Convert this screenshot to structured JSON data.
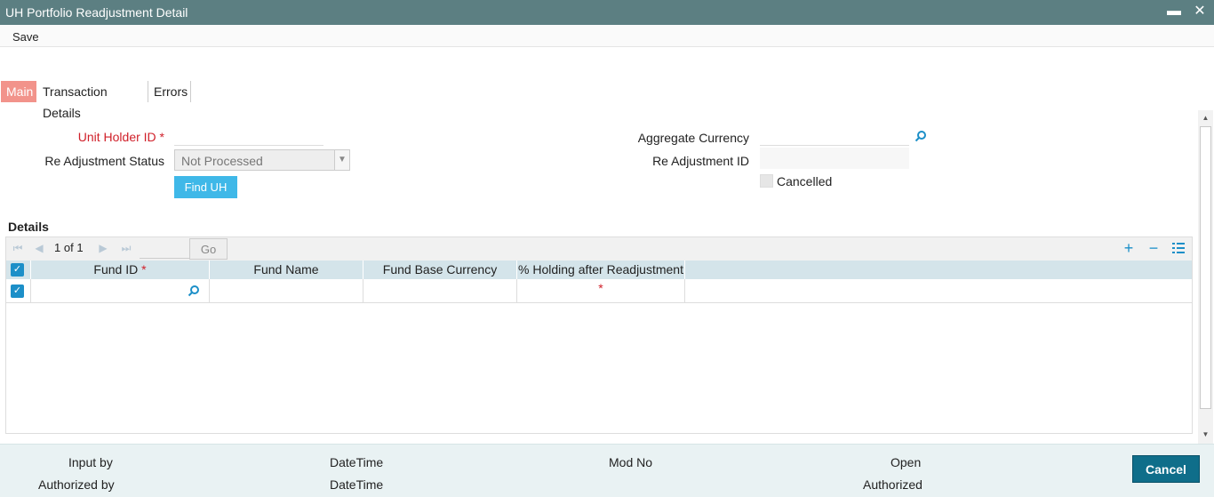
{
  "window": {
    "title": "UH Portfolio Readjustment Detail",
    "minimize_glyph": "▬",
    "close_glyph": "✕"
  },
  "toolbar": {
    "save_label": "Save"
  },
  "tabs": [
    {
      "label": "Main",
      "active": true
    },
    {
      "label": "Transaction Details",
      "active": false
    },
    {
      "label": "Errors",
      "active": false
    }
  ],
  "form": {
    "unit_holder_id": {
      "label": "Unit Holder ID",
      "required_mark": "*",
      "value": ""
    },
    "readjustment_status": {
      "label": "Re Adjustment Status",
      "value": "Not Processed"
    },
    "find_uh_label": "Find UH",
    "aggregate_currency": {
      "label": "Aggregate Currency",
      "value": ""
    },
    "readjustment_id": {
      "label": "Re Adjustment ID",
      "value": ""
    },
    "cancelled": {
      "label": "Cancelled",
      "checked": false
    }
  },
  "details": {
    "title": "Details",
    "pager": {
      "current": "1",
      "of_label": "of",
      "total": "1",
      "go_label": "Go"
    },
    "columns": [
      {
        "label": "Fund ID",
        "required_mark": "*"
      },
      {
        "label": "Fund Name",
        "required_mark": ""
      },
      {
        "label": "Fund Base Currency",
        "required_mark": ""
      },
      {
        "label": "% Holding after Readjustment",
        "required_mark": "*"
      }
    ],
    "rows": [
      {
        "fund_id": "",
        "fund_name": "",
        "fund_base_currency": "",
        "holding_pct": ""
      }
    ]
  },
  "footer": {
    "input_by": "Input by",
    "authorized_by": "Authorized by",
    "datetime_1": "DateTime",
    "datetime_2": "DateTime",
    "mod_no": "Mod No",
    "open": "Open",
    "authorized": "Authorized",
    "cancel_label": "Cancel"
  },
  "colors": {
    "titlebar": "#5c7f82",
    "active_tab": "#f2938b",
    "button": "#3fb8e8",
    "accent": "#1c8fc8",
    "cancel": "#0f6e8a",
    "required": "#d0202a"
  },
  "icons": [
    "search-icon",
    "first-page-icon",
    "prev-page-icon",
    "next-page-icon",
    "last-page-icon",
    "add-row-icon",
    "delete-row-icon",
    "single-view-icon",
    "checkbox-icon"
  ]
}
